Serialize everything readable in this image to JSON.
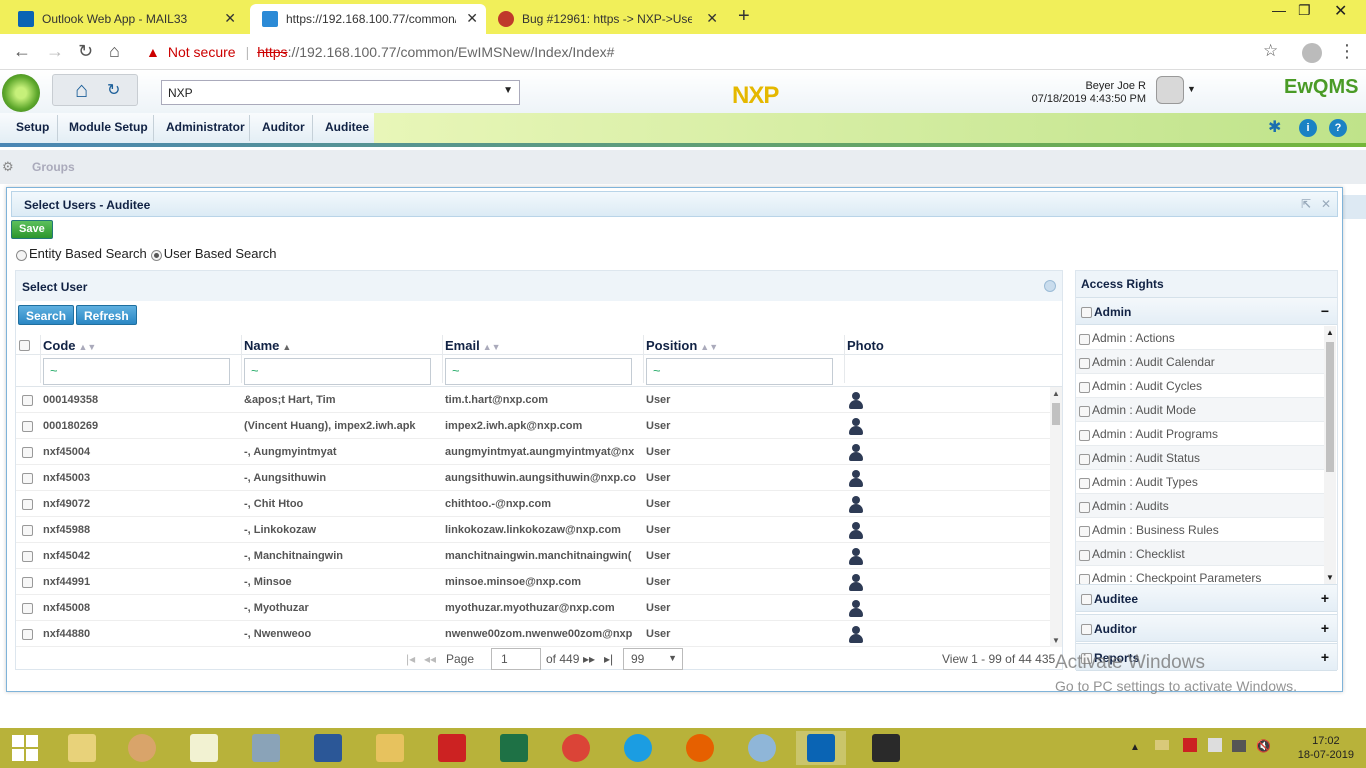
{
  "browser": {
    "tabs": [
      {
        "label": "Outlook Web App - MAIL33",
        "color": "#0a64b4"
      },
      {
        "label": "https://192.168.100.77/common/",
        "color": "#2b8ad6"
      },
      {
        "label": "Bug #12961: https -> NXP->Use",
        "color": "#c0392b"
      }
    ],
    "not_secure": "Not secure",
    "url_scheme": "https",
    "url_rest": "://192.168.100.77/common/EwIMSNew/Index/Index#"
  },
  "header": {
    "org_value": "NXP",
    "brand": "NXP",
    "user_name": "Beyer Joe R",
    "datetime": "07/18/2019 4:43:50 PM",
    "product": "EwQMS"
  },
  "menu": {
    "items": [
      "Setup",
      "Module Setup",
      "Administrator",
      "Auditor",
      "Auditee"
    ]
  },
  "breadcrumb": "Groups",
  "dialog": {
    "title": "Select Users - Auditee",
    "save": "Save",
    "search_modes": [
      "Entity Based Search",
      "User Based Search"
    ]
  },
  "select_user": {
    "title": "Select User",
    "search_btn": "Search",
    "refresh_btn": "Refresh",
    "columns": [
      "Code",
      "Name",
      "Email",
      "Position",
      "Photo"
    ],
    "filters": [
      "~",
      "~",
      "~",
      "~"
    ],
    "rows": [
      {
        "code": "000149358",
        "name": "&apos;t Hart, Tim",
        "email": "tim.t.hart@nxp.com",
        "position": "User"
      },
      {
        "code": "000180269",
        "name": "(Vincent Huang), impex2.iwh.apk",
        "email": "impex2.iwh.apk@nxp.com",
        "position": "User"
      },
      {
        "code": "nxf45004",
        "name": "-, Aungmyintmyat",
        "email": "aungmyintmyat.aungmyintmyat@nx",
        "position": "User"
      },
      {
        "code": "nxf45003",
        "name": "-, Aungsithuwin",
        "email": "aungsithuwin.aungsithuwin@nxp.co",
        "position": "User"
      },
      {
        "code": "nxf49072",
        "name": "-, Chit Htoo",
        "email": "chithtoo.-@nxp.com",
        "position": "User"
      },
      {
        "code": "nxf45988",
        "name": "-, Linkokozaw",
        "email": "linkokozaw.linkokozaw@nxp.com",
        "position": "User"
      },
      {
        "code": "nxf45042",
        "name": "-, Manchitnaingwin",
        "email": "manchitnaingwin.manchitnaingwin(",
        "position": "User"
      },
      {
        "code": "nxf44991",
        "name": "-, Minsoe",
        "email": "minsoe.minsoe@nxp.com",
        "position": "User"
      },
      {
        "code": "nxf45008",
        "name": "-, Myothuzar",
        "email": "myothuzar.myothuzar@nxp.com",
        "position": "User"
      },
      {
        "code": "nxf44880",
        "name": "-, Nwenweoo",
        "email": "nwenwe00zom.nwenwe00zom@nxp",
        "position": "User"
      }
    ],
    "pager": {
      "page_label": "Page",
      "page": "1",
      "of": "of 449",
      "page_size": "99",
      "view": "View 1 - 99 of 44 435"
    }
  },
  "access_rights": {
    "title": "Access Rights",
    "sections": [
      {
        "label": "Admin",
        "toggle": "−"
      },
      {
        "label": "Auditee",
        "toggle": "+"
      },
      {
        "label": "Auditor",
        "toggle": "+"
      },
      {
        "label": "Reports",
        "toggle": "+"
      }
    ],
    "admin_items": [
      "Admin : Actions",
      "Admin : Audit Calendar",
      "Admin : Audit Cycles",
      "Admin : Audit Mode",
      "Admin : Audit Programs",
      "Admin : Audit Status",
      "Admin : Audit Types",
      "Admin : Audits",
      "Admin : Business Rules",
      "Admin : Checklist",
      "Admin : Checkpoint Parameters"
    ]
  },
  "watermark": {
    "line1": "Activate Windows",
    "line2": "Go to PC settings to activate Windows."
  },
  "taskbar": {
    "time": "17:02",
    "date": "18-07-2019"
  }
}
